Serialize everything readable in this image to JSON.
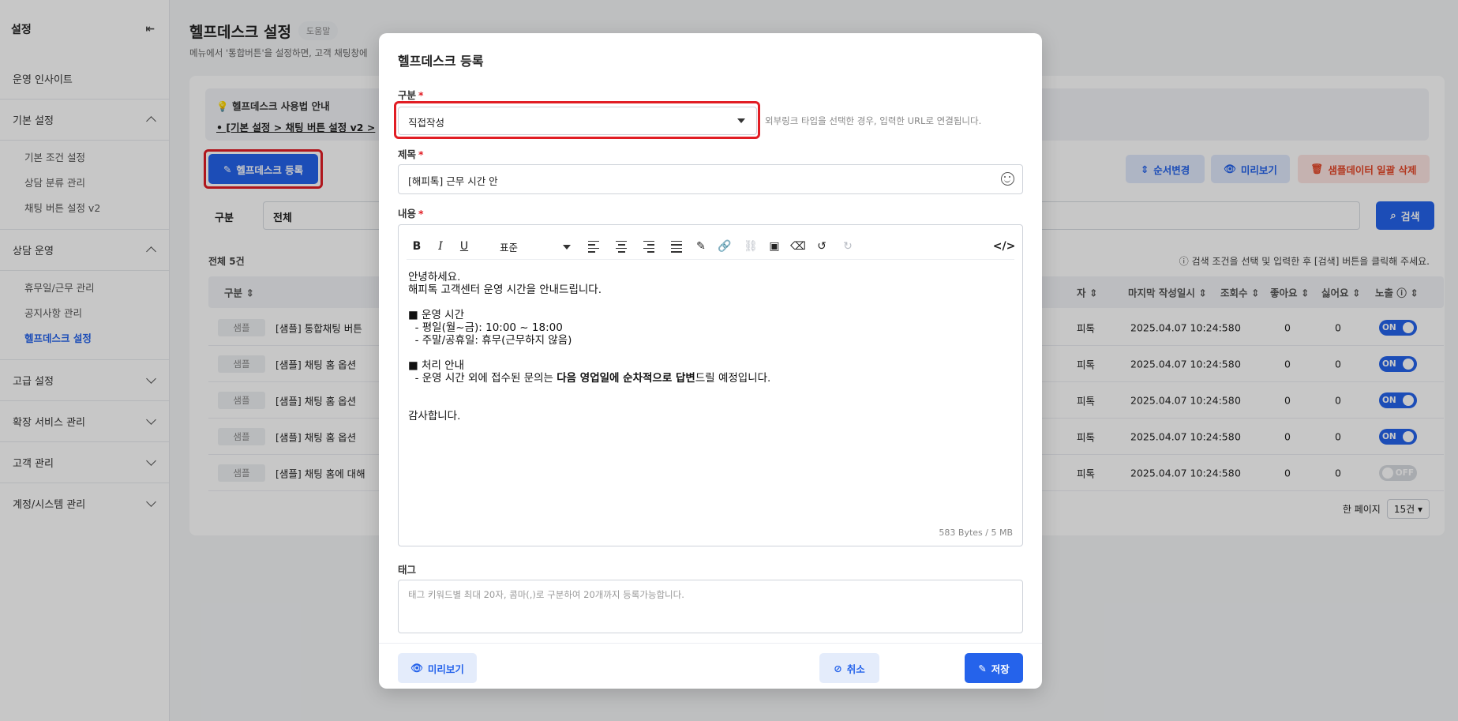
{
  "sidebar": {
    "title": "설정",
    "items": [
      {
        "label": "운영 인사이트"
      },
      {
        "label": "기본 설정",
        "expanded": true,
        "children": [
          "기본 조건 설정",
          "상담 분류 관리",
          "채팅 버튼 설정 v2"
        ]
      },
      {
        "label": "상담 운영",
        "expanded": true,
        "children": [
          "휴무일/근무 관리",
          "공지사항 관리",
          "헬프데스크 설정"
        ]
      },
      {
        "label": "고급 설정"
      },
      {
        "label": "확장 서비스 관리"
      },
      {
        "label": "고객 관리"
      },
      {
        "label": "계정/시스템 관리"
      }
    ]
  },
  "page": {
    "title": "헬프데스크 설정",
    "help_badge": "도움말",
    "subtitle": "메뉴에서 '통합버튼'을 설정하면, 고객 채팅창에",
    "guide_title": "헬프데스크 사용법 안내",
    "guide_link": "[기본 설정 > 채팅 버튼 설정 v2 > ",
    "register_button": "헬프데스크 등록",
    "reorder_button": "순서변경",
    "preview_button": "미리보기",
    "delete_sample_button": "샘플데이터 일괄 삭제",
    "filter_label": "구분",
    "filter_value": "전체",
    "search_button": "검색",
    "total": "전체 5건",
    "hint": "검색 조건을 선택 및 입력한 후 [검색] 버튼을 클릭해 주세요.",
    "per_page_label": "한 페이지",
    "per_page_value": "15건"
  },
  "table": {
    "headers": {
      "type": "구분",
      "author": "자",
      "last_date": "마지막 작성일시",
      "views": "조회수",
      "likes": "좋아요",
      "dislikes": "싫어요",
      "exposure": "노출"
    },
    "rows": [
      {
        "type": "샘플",
        "title": "[샘플] 통합채팅 버튼",
        "author": "피톡",
        "date": "2025.04.07 10:24:58",
        "views": "0",
        "likes": "0",
        "dislikes": "0",
        "toggle": "ON"
      },
      {
        "type": "샘플",
        "title": "[샘플] 채팅 홈 옵션",
        "author": "피톡",
        "date": "2025.04.07 10:24:58",
        "views": "0",
        "likes": "0",
        "dislikes": "0",
        "toggle": "ON"
      },
      {
        "type": "샘플",
        "title": "[샘플] 채팅 홈 옵션",
        "author": "피톡",
        "date": "2025.04.07 10:24:58",
        "views": "0",
        "likes": "0",
        "dislikes": "0",
        "toggle": "ON"
      },
      {
        "type": "샘플",
        "title": "[샘플] 채팅 홈 옵션",
        "author": "피톡",
        "date": "2025.04.07 10:24:58",
        "views": "0",
        "likes": "0",
        "dislikes": "0",
        "toggle": "ON"
      },
      {
        "type": "샘플",
        "title": "[샘플] 채팅 홈에 대해",
        "author": "피톡",
        "date": "2025.04.07 10:24:58",
        "views": "0",
        "likes": "0",
        "dislikes": "0",
        "toggle": "OFF"
      }
    ]
  },
  "modal": {
    "title": "헬프데스크 등록",
    "type_label": "구분",
    "type_value": "직접작성",
    "type_hint": "외부링크 타입을 선택한 경우, 입력한 URL로 연결됩니다.",
    "title_label": "제목",
    "title_value": "[해피톡] 근무 시간 안",
    "content_label": "내용",
    "font_select": "표준",
    "content": {
      "l1": "안녕하세요.",
      "l2": "해피톡 고객센터 운영 시간을 안내드립니다.",
      "l3": "■ 운영 시간",
      "l4": "  - 평일(월~금): 10:00 ~ 18:00",
      "l5": "  - 주말/공휴일: 휴무(근무하지 않음)",
      "l6": "■ 처리 안내",
      "l7a": "  - 운영 시간 외에 접수된 문의는 ",
      "l7b": "다음 영업일에 순차적으로 답변",
      "l7c": "드릴 예정입니다.",
      "l8": "감사합니다."
    },
    "bytes": "583 Bytes / 5 MB",
    "tag_label": "태그",
    "tag_placeholder": "태그 키워드별 최대 20자, 콤마(,)로 구분하여 20개까지 등록가능합니다.",
    "preview_button": "미리보기",
    "cancel_button": "취소",
    "save_button": "저장"
  },
  "colors": {
    "primary": "#2563eb",
    "danger": "#e11d24",
    "required": "#e11d24"
  }
}
